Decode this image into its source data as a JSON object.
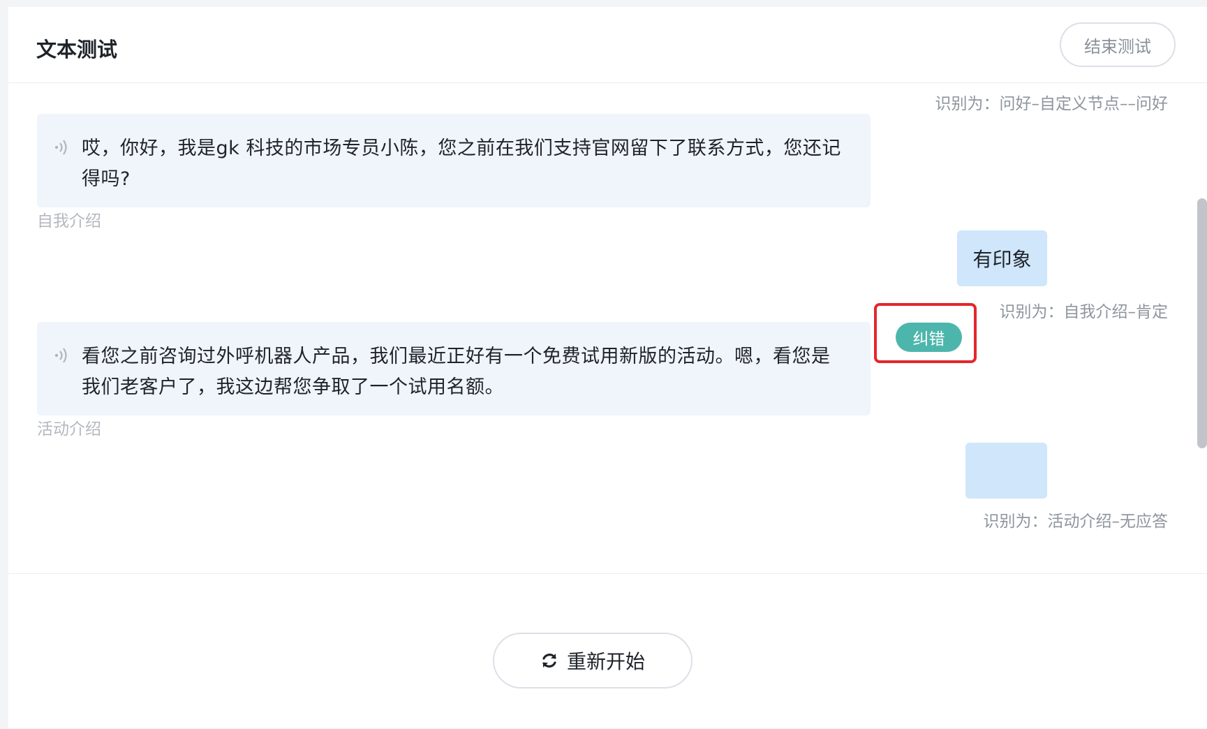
{
  "header": {
    "title": "文本测试",
    "end_button_label": "结束测试"
  },
  "conversation": {
    "recognized_1": "识别为：问好–自定义节点––问好",
    "bot_message_1": "哎，你好，我是gk 科技的市场专员小陈，您之前在我们支持官网留下了联系方式，您还记得吗?",
    "node_1": "自我介绍",
    "user_message_1": "有印象",
    "correct_button_label": "纠错",
    "recognized_2": "识别为：自我介绍–肯定",
    "bot_message_2": "看您之前咨询过外呼机器人产品，我们最近正好有一个免费试用新版的活动。嗯，看您是我们老客户了，我这边帮您争取了一个试用名额。",
    "node_2": "活动介绍",
    "user_message_2": "",
    "recognized_3": "识别为：活动介绍–无应答"
  },
  "footer": {
    "restart_button_label": "重新开始"
  },
  "colors": {
    "bot_bubble": "#f0f4fb",
    "user_bubble": "#cfe6fb",
    "correct_button": "#4db6ac",
    "highlight_box": "#e5262b"
  },
  "icons": {
    "bot_voice": "sound-icon",
    "restart": "refresh-icon"
  }
}
